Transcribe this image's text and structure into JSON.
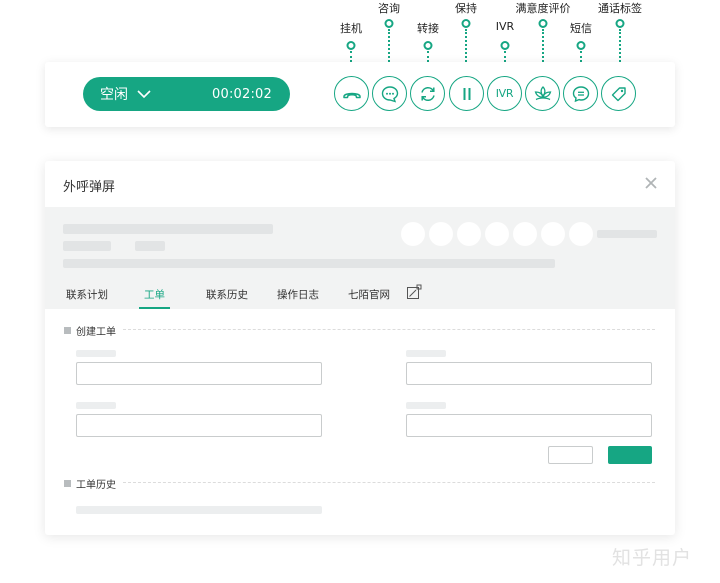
{
  "callbar": {
    "status_label": "空闲",
    "timer": "00:02:02",
    "accent_color": "#16a683",
    "tools": [
      {
        "name": "hangup",
        "label": "挂机",
        "icon": "phone-hangup-icon"
      },
      {
        "name": "consult",
        "label": "咨询",
        "icon": "chat-bubble-dots-icon"
      },
      {
        "name": "transfer",
        "label": "转接",
        "icon": "refresh-arrows-icon"
      },
      {
        "name": "hold",
        "label": "保持",
        "icon": "pause-icon"
      },
      {
        "name": "ivr",
        "label": "IVR",
        "icon": "ivr-text-icon",
        "button_text": "IVR"
      },
      {
        "name": "satisfaction",
        "label": "满意度评价",
        "icon": "lotus-icon"
      },
      {
        "name": "sms",
        "label": "短信",
        "icon": "message-icon"
      },
      {
        "name": "call-tag",
        "label": "通话标签",
        "icon": "tag-icon"
      }
    ]
  },
  "popup": {
    "title": "外呼弹屏",
    "close_icon": "close-icon",
    "tabs": [
      {
        "label": "联系计划",
        "active": false
      },
      {
        "label": "工单",
        "active": true
      },
      {
        "label": "联系历史",
        "active": false
      },
      {
        "label": "操作日志",
        "active": false
      },
      {
        "label": "七陌官网",
        "active": false
      }
    ],
    "external_icon": "external-link-icon",
    "sections": {
      "create_ticket": "创建工单",
      "ticket_history": "工单历史"
    }
  },
  "watermark": "知乎用户"
}
